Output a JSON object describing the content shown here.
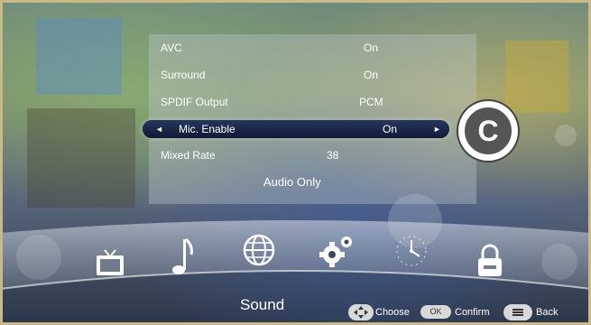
{
  "menu": {
    "rows": [
      {
        "label": "AVC",
        "value": "On"
      },
      {
        "label": "Surround",
        "value": "On"
      },
      {
        "label": "SPDIF Output",
        "value": "PCM"
      }
    ],
    "selected": {
      "label": "Mic. Enable",
      "value": "On",
      "left_arrow": "◄",
      "right_arrow": "►"
    },
    "mixed_rate": {
      "label": "Mixed Rate",
      "value": "38"
    },
    "mode": "Audio Only"
  },
  "badge": "C",
  "dock": {
    "icons": [
      "tv-icon",
      "music-note-icon",
      "globe-icon",
      "gear-icon",
      "clock-icon",
      "lock-icon"
    ],
    "active_label": "Sound"
  },
  "footer": {
    "choose": "Choose",
    "ok": "OK",
    "confirm": "Confirm",
    "back": "Back"
  },
  "colors": {
    "selection_bar": "#1b274a",
    "accent": "#ffffff"
  }
}
